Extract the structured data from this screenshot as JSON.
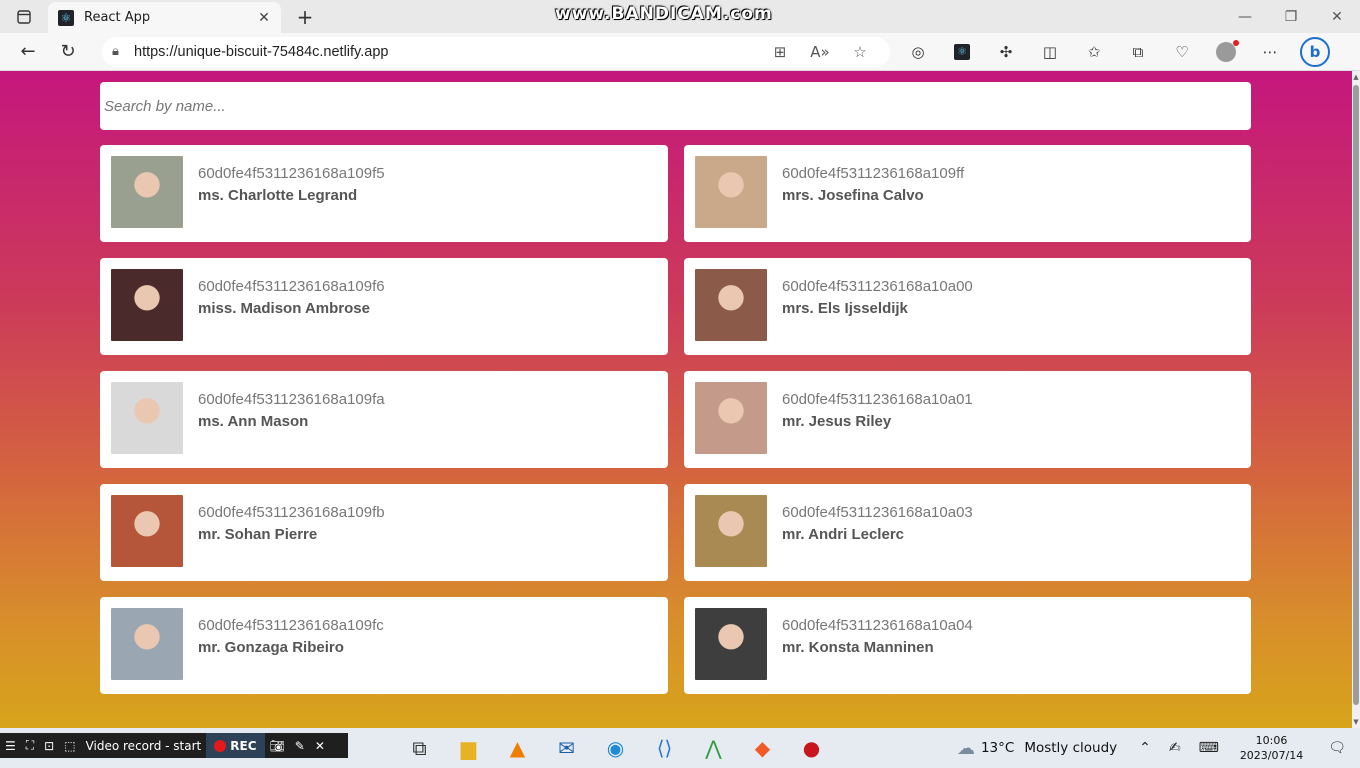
{
  "browser": {
    "tab_title": "React App",
    "tab_close": "✕",
    "new_tab": "+",
    "url": "https://unique-biscuit-75484c.netlify.app",
    "watermark": "www.BANDICAM.com"
  },
  "page": {
    "search_placeholder": "Search by name...",
    "users": [
      {
        "id": "60d0fe4f5311236168a109f5",
        "name": "ms. Charlotte Legrand",
        "avatar_color": "#9aa08f"
      },
      {
        "id": "60d0fe4f5311236168a109ff",
        "name": "mrs. Josefina Calvo",
        "avatar_color": "#c9a98a"
      },
      {
        "id": "60d0fe4f5311236168a109f6",
        "name": "miss. Madison Ambrose",
        "avatar_color": "#4a2a2a"
      },
      {
        "id": "60d0fe4f5311236168a10a00",
        "name": "mrs. Els Ijsseldijk",
        "avatar_color": "#8b5a48"
      },
      {
        "id": "60d0fe4f5311236168a109fa",
        "name": "ms. Ann Mason",
        "avatar_color": "#d9d9d9"
      },
      {
        "id": "60d0fe4f5311236168a10a01",
        "name": "mr. Jesus Riley",
        "avatar_color": "#c49a8a"
      },
      {
        "id": "60d0fe4f5311236168a109fb",
        "name": "mr. Sohan Pierre",
        "avatar_color": "#b5553a"
      },
      {
        "id": "60d0fe4f5311236168a10a03",
        "name": "mr. Andri Leclerc",
        "avatar_color": "#a88a52"
      },
      {
        "id": "60d0fe4f5311236168a109fc",
        "name": "mr. Gonzaga Ribeiro",
        "avatar_color": "#9aa7b3"
      },
      {
        "id": "60d0fe4f5311236168a10a04",
        "name": "mr. Konsta Manninen",
        "avatar_color": "#3e3e3e"
      }
    ]
  },
  "taskbar": {
    "recorder_label": "Video record - start",
    "rec_label": "REC",
    "weather_temp": "13°C",
    "weather_desc": "Mostly cloudy",
    "time": "10:06",
    "date": "2023/07/14"
  },
  "colors": {
    "gradient_top": "#c5177d",
    "gradient_bottom": "#d7a41a"
  }
}
